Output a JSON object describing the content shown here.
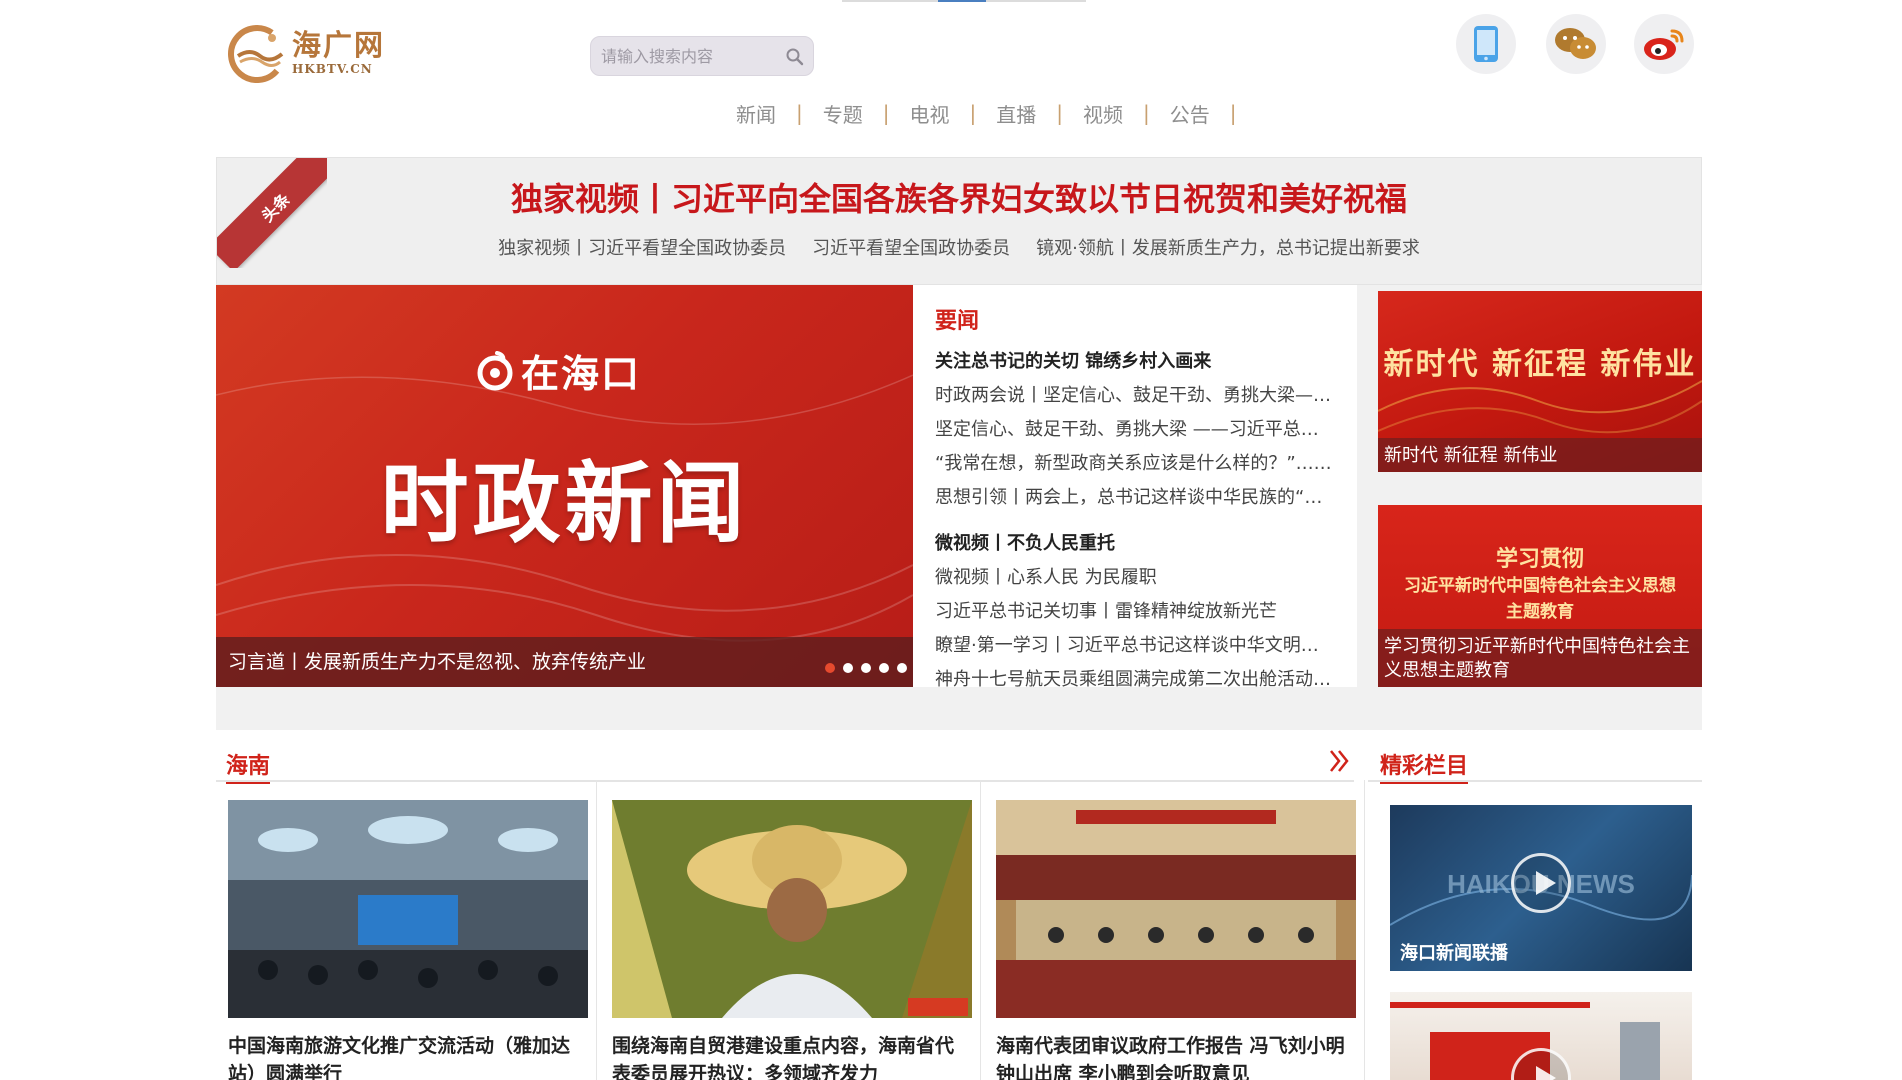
{
  "header": {
    "logo_cn": "海广网",
    "logo_en": "HKBTV.CN",
    "search_placeholder": "请输入搜索内容",
    "social": [
      "mobile-icon",
      "wechat-icon",
      "weibo-icon"
    ]
  },
  "nav": [
    "新闻",
    "专题",
    "电视",
    "直播",
    "视频",
    "公告"
  ],
  "headline": {
    "ribbon": "头条",
    "title": "独家视频丨习近平向全国各族各界妇女致以节日祝贺和美好祝福",
    "subs": [
      "独家视频丨习近平看望全国政协委员",
      "习近平看望全国政协委员",
      "镜观·领航丨发展新质生产力，总书记提出新要求"
    ]
  },
  "carousel": {
    "brand": "在海口",
    "main": "时政新闻",
    "caption": "习言道丨发展新质生产力不是忽视、放弃传统产业",
    "slides": 5,
    "active": 1
  },
  "yaowen": {
    "title": "要闻",
    "group1": [
      {
        "text": "关注总书记的关切 锦绣乡村入画来",
        "bold": true
      },
      {
        "text": "时政两会说丨坚定信心、鼓足干劲、勇挑大梁——习近平总书记",
        "bold": false
      },
      {
        "text": "坚定信心、鼓足干劲、勇挑大梁 ——习近平总书记",
        "bold": false
      },
      {
        "text": "“我常在想，新型政商关系应该是什么样的？”……",
        "bold": false
      },
      {
        "text": "思想引领丨两会上，总书记这样谈中华民族的“……",
        "bold": false
      }
    ],
    "group2": [
      {
        "text": "微视频丨不负人民重托",
        "bold": true
      },
      {
        "text": "微视频丨心系人民 为民履职",
        "bold": false
      },
      {
        "text": "习近平总书记关切事丨雷锋精神绽放新光芒",
        "bold": false
      },
      {
        "text": "瞭望·第一学习丨习近平总书记这样谈中华文明的……",
        "bold": false
      },
      {
        "text": "神舟十七号航天员乘组圆满完成第二次出舱活动……",
        "bold": false
      }
    ]
  },
  "side_cards": {
    "card1_title": "新时代 新征程 新伟业",
    "card1_caption": "新时代 新征程 新伟业",
    "card2_line1": "学习贯彻",
    "card2_line2": "习近平新时代中国特色社会主义思想",
    "card2_line3": "主题教育",
    "card2_caption": "学习贯彻习近平新时代中国特色社会主义思想主题教育"
  },
  "hainan": {
    "title": "海南",
    "articles": [
      {
        "title": "中国海南旅游文化推广交流活动（雅加达站）圆满举行"
      },
      {
        "title": "围绕海南自贸港建设重点内容，海南省代表委员展开热议：多领域齐发力"
      },
      {
        "title": "海南代表团审议政府工作报告 冯飞刘小明钟山出席 李小鹏到会听取意见"
      }
    ]
  },
  "columns": {
    "title": "精彩栏目",
    "items": [
      {
        "label": "海口新闻联播"
      },
      {
        "label": ""
      }
    ]
  },
  "colors": {
    "accent_red": "#d0231a",
    "headline_red": "#c7171b",
    "logo_gold": "#b6763a"
  }
}
